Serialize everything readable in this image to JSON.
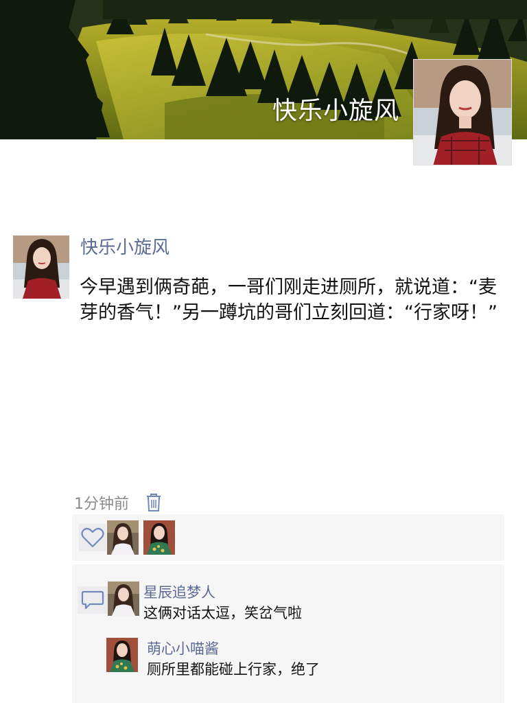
{
  "profile": {
    "cover_name": "快乐小旋风"
  },
  "post": {
    "author": "快乐小旋风",
    "text": "今早遇到俩奇葩，一哥们刚走进厕所，就说道：“麦芽的香气！”另一蹲坑的哥们立刻回道：“行家呀！”",
    "time": "1分钟前"
  },
  "likes": {
    "icon": "heart-icon",
    "avatars": [
      "avatar-girl-white-top",
      "avatar-girl-green-dress"
    ]
  },
  "comments": [
    {
      "author": "星辰追梦人",
      "text": "这俩对话太逗，笑岔气啦",
      "avatar": "avatar-girl-white-top"
    },
    {
      "author": "萌心小喵酱",
      "text": "厕所里都能碰上行家，绝了",
      "avatar": "avatar-girl-green-dress"
    }
  ],
  "colors": {
    "link_blue": "#5b6b96",
    "icon_blue": "#6f89bf",
    "panel_bg": "#f6f6f7"
  }
}
